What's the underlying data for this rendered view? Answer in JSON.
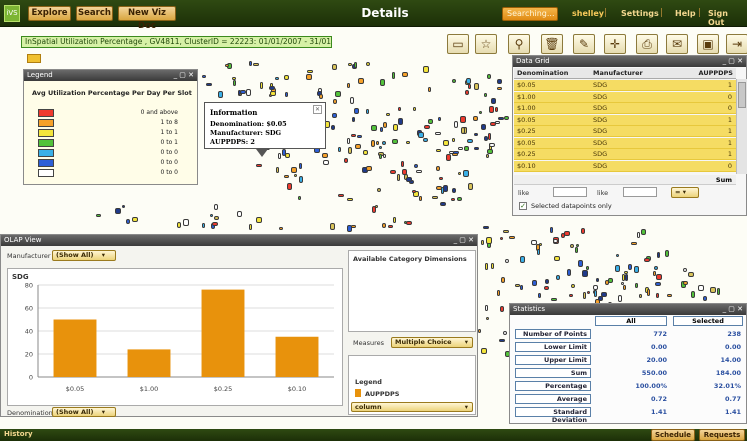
{
  "app": {
    "title": "Details",
    "nav": [
      "Explore",
      "Search",
      "New Viz Doc"
    ],
    "search_status": "Searching...",
    "user": "shelley",
    "links": [
      "Settings",
      "Help",
      "Sign Out"
    ],
    "separator": "|",
    "logo_text": "iVS"
  },
  "params": "InSpatial Utilization Percentage , GV4811, ClusterID = 22223: 01/01/2007 - 31/01/2007",
  "toolbar": {
    "icons": [
      "select-rectangle-icon",
      "star-icon",
      "zoom-icon",
      "trash-icon",
      "eraser-icon",
      "crosshair-icon",
      "print-icon",
      "email-icon",
      "save-icon",
      "exit-icon"
    ],
    "glyphs": [
      "▭",
      "☆",
      "⚲",
      "🗑",
      "✎",
      "✛",
      "⎙",
      "✉",
      "▣",
      "⇥"
    ]
  },
  "legend_panel": {
    "title": "Legend",
    "controls": "_ ▢ ✕",
    "heading": "Avg Utilization Percentage Per Day Per Slot",
    "items": [
      {
        "color": "#ef3a2e",
        "label": "0 and above"
      },
      {
        "color": "#f6a12a",
        "label": "1 to 8"
      },
      {
        "color": "#f3e43b",
        "label": "1 to 1"
      },
      {
        "color": "#52c23a",
        "label": "0 to 1"
      },
      {
        "color": "#3ab0e8",
        "label": "0 to 0"
      },
      {
        "color": "#2d5fd6",
        "label": "0 to 0"
      },
      {
        "color": "#ffffff",
        "label": "0 to 0"
      }
    ]
  },
  "info_popup": {
    "title": "Information",
    "close": "✕",
    "denomination_label": "Denomination: $0.05",
    "manufacturer_label": "Manufacturer: SDG",
    "auppdps_label": "AUPPDPS: 2"
  },
  "data_grid": {
    "title": "Data Grid",
    "controls": "_ ▢ ✕",
    "columns": [
      "Denomination",
      "Manufacturer",
      "AUPPDPS"
    ],
    "rows": [
      [
        "$0.05",
        "SDG",
        "1"
      ],
      [
        "$1.00",
        "SDG",
        "0"
      ],
      [
        "$1.00",
        "SDG",
        "0"
      ],
      [
        "$0.05",
        "SDG",
        "1"
      ],
      [
        "$0.25",
        "SDG",
        "1"
      ],
      [
        "$0.05",
        "SDG",
        "1"
      ],
      [
        "$0.25",
        "SDG",
        "1"
      ],
      [
        "$0.10",
        "SDG",
        "0"
      ]
    ],
    "sum_label": "Sum",
    "filter1": "like",
    "filter2": "like",
    "op": "=",
    "selected_only": "Selected datapoints only"
  },
  "olap": {
    "title": "OLAP View",
    "controls": "_ ▢ ✕",
    "manufacturer_label": "Manufacturer",
    "manufacturer_value": "(Show All)",
    "chart_title": "SDG",
    "denomination_label": "Denomination",
    "denomination_value": "(Show All)",
    "avail_title": "Available Category Dimensions",
    "measures_label": "Measures",
    "measures_value": "Multiple Choice",
    "legend_title": "Legend",
    "legend_item": "AUPPDPS",
    "chart_type": "column"
  },
  "chart_data": {
    "type": "bar",
    "title": "SDG",
    "categories": [
      "$0.05",
      "$1.00",
      "$0.25",
      "$0.10"
    ],
    "series": [
      {
        "name": "AUPPDPS",
        "values": [
          50,
          24,
          76,
          35
        ]
      }
    ],
    "ylim": [
      0,
      80
    ],
    "yticks": [
      0,
      20,
      40,
      60,
      80
    ],
    "color": "#e8920c",
    "grid": true
  },
  "stats": {
    "title": "Statistics",
    "controls": "_ ▢ ✕",
    "col_all": "All",
    "col_selected": "Selected",
    "rows": [
      {
        "label": "Number of Points",
        "all": "772",
        "selected": "238"
      },
      {
        "label": "Lower Limit",
        "all": "0.00",
        "selected": "0.00"
      },
      {
        "label": "Upper Limit",
        "all": "20.00",
        "selected": "14.00"
      },
      {
        "label": "Sum",
        "all": "550.00",
        "selected": "184.00"
      },
      {
        "label": "Percentage",
        "all": "100.00%",
        "selected": "32.01%"
      },
      {
        "label": "Average",
        "all": "0.72",
        "selected": "0.77"
      },
      {
        "label": "Standard Deviation",
        "all": "1.41",
        "selected": "1.41"
      }
    ]
  },
  "footer": {
    "history": "History",
    "schedule": "Schedule",
    "requests": "Requests"
  }
}
